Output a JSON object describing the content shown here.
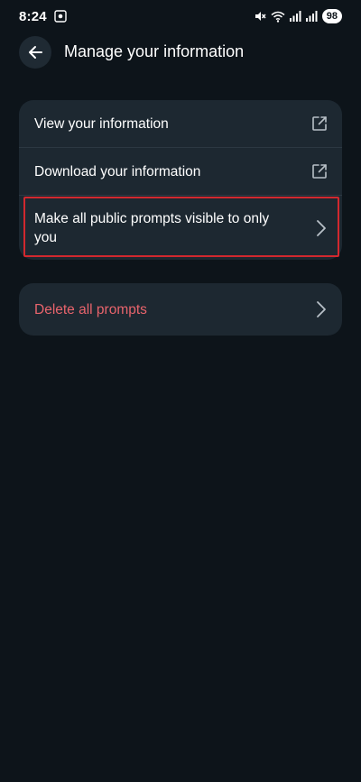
{
  "status_bar": {
    "time": "8:24",
    "battery": "98"
  },
  "header": {
    "title": "Manage your information"
  },
  "card_info": {
    "items": [
      {
        "label": "View your information",
        "icon": "external-link-icon"
      },
      {
        "label": "Download your information",
        "icon": "external-link-icon"
      },
      {
        "label": "Make all public prompts visible to only you",
        "icon": "chevron-right-icon"
      }
    ]
  },
  "card_delete": {
    "label": "Delete all prompts",
    "icon": "chevron-right-icon"
  },
  "colors": {
    "background": "#0d141a",
    "card": "#1d2831",
    "danger": "#e8646c",
    "highlight": "#d2282e"
  }
}
